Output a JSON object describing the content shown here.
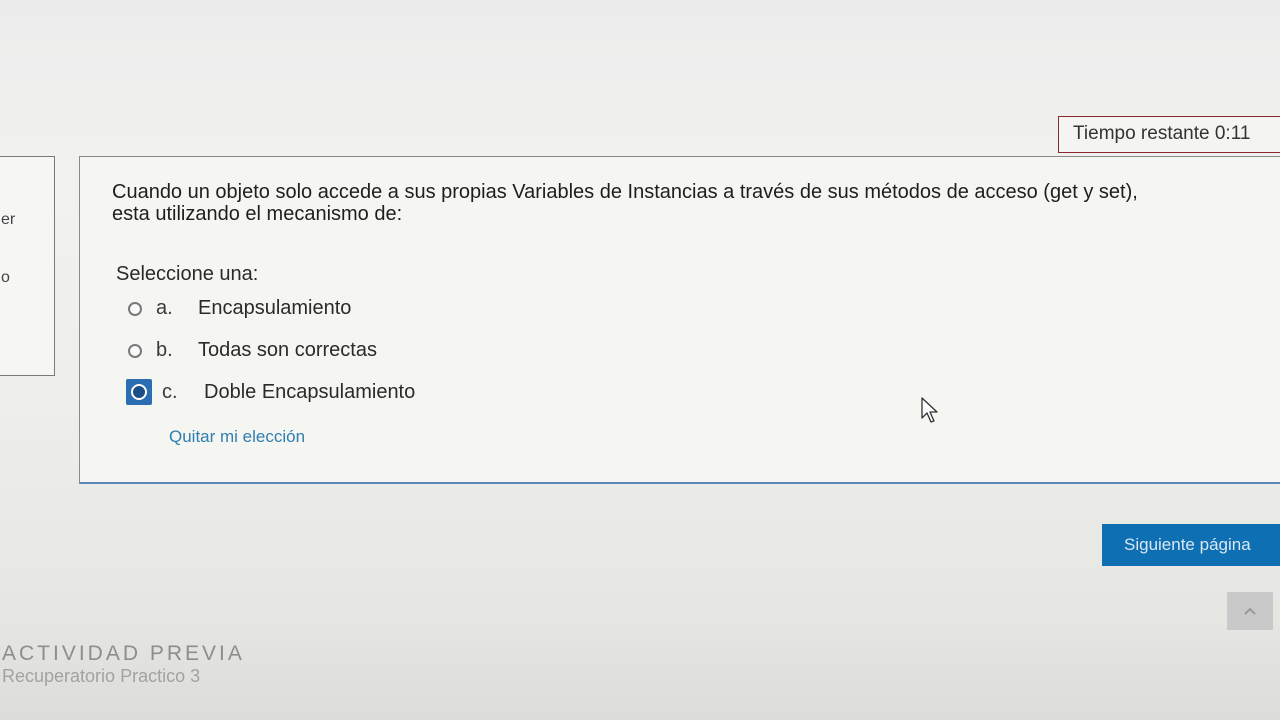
{
  "timer": {
    "label": "Tiempo restante 0:11"
  },
  "left_panel": {
    "text_a": "er",
    "text_b": "o"
  },
  "question": {
    "text_line1": "Cuando un objeto solo accede a sus propias Variables de Instancias a través de sus métodos de acceso (get y set),",
    "text_line2": "esta utilizando el mecanismo de:",
    "prompt": "Seleccione una:",
    "options": [
      {
        "letter": "a.",
        "label": "Encapsulamiento",
        "selected": false
      },
      {
        "letter": "b.",
        "label": "Todas son correctas",
        "selected": false
      },
      {
        "letter": "c.",
        "label": "Doble Encapsulamiento",
        "selected": true
      }
    ],
    "clear_label": "Quitar mi elección"
  },
  "navigation": {
    "next_label": "Siguiente página"
  },
  "previous_activity": {
    "heading": "ACTIVIDAD PREVIA",
    "link": "Recuperatorio Practico 3"
  },
  "colors": {
    "accent": "#0e6fb3",
    "link": "#2f7fb0",
    "timer_border": "#8a2a2a"
  },
  "icons": {
    "scroll_top": "chevron-up-icon",
    "cursor": "mouse-pointer-icon"
  }
}
